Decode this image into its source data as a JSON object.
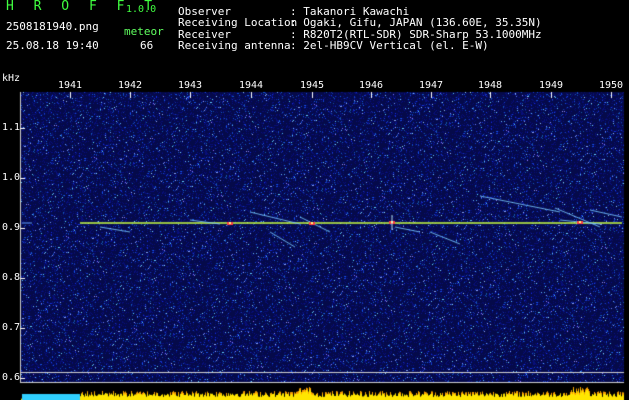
{
  "app": {
    "title": "H R O F F T",
    "version": "1.0.0"
  },
  "file": {
    "name": "2508181940.png",
    "datetime": "25.08.18 19:40"
  },
  "meteor": {
    "label": "meteor",
    "count": "66"
  },
  "station": {
    "observer_label": "Observer",
    "observer_value": ": Takanori Kawachi",
    "location_label": "Receiving Location",
    "location_value": ": Ogaki, Gifu, JAPAN (136.60E, 35.35N)",
    "receiver_label": "Receiver",
    "receiver_value": ": R820T2(RTL-SDR) SDR-Sharp 53.1000MHz",
    "antenna_label": "Receiving antenna",
    "antenna_value": ": 2el-HB9CV Vertical (el. E-W)"
  },
  "axes": {
    "y_unit": "kHz",
    "y_ticks": [
      "1.1",
      "1.0",
      "0.9",
      "0.8",
      "0.7",
      "0.6"
    ],
    "x_ticks": [
      "1941",
      "1942",
      "1943",
      "1944",
      "1945",
      "1946",
      "1947",
      "1948",
      "1949",
      "1950"
    ]
  },
  "colors": {
    "background": "#000000",
    "header_green": "#40ff40",
    "spectrogram_bg": "#050a4a",
    "carrier_line": "#c8ff40",
    "power_bar": "#ffe600"
  }
}
